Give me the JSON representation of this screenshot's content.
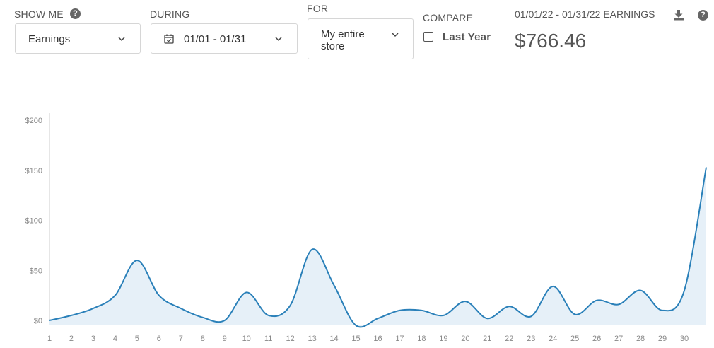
{
  "controls": {
    "show_me": {
      "label": "SHOW ME",
      "value": "Earnings"
    },
    "during": {
      "label": "DURING",
      "value": "01/01 - 01/31"
    },
    "for": {
      "label": "FOR",
      "value_line1": "My entire",
      "value_line2": "store"
    },
    "compare": {
      "label": "COMPARE",
      "option": "Last Year",
      "checked": false
    }
  },
  "summary": {
    "label": "01/01/22 - 01/31/22 EARNINGS",
    "value": "$766.46"
  },
  "icons": {
    "help": "help-icon",
    "download": "download-icon",
    "calendar": "calendar-icon",
    "chevron": "chevron-down-icon"
  },
  "colors": {
    "line": "#2a80b9",
    "area": "#e6f0f8",
    "axis": "#cccccc",
    "tick_text": "#888888"
  },
  "chart_data": {
    "type": "area",
    "x": [
      1,
      2,
      3,
      4,
      5,
      6,
      7,
      8,
      9,
      10,
      11,
      12,
      13,
      14,
      15,
      16,
      17,
      18,
      19,
      20,
      21,
      22,
      23,
      24,
      25,
      26,
      27,
      28,
      29,
      30,
      31
    ],
    "xticks": [
      "1",
      "2",
      "3",
      "4",
      "5",
      "6",
      "7",
      "8",
      "9",
      "10",
      "11",
      "12",
      "13",
      "14",
      "15",
      "16",
      "17",
      "18",
      "19",
      "20",
      "21",
      "22",
      "23",
      "24",
      "25",
      "26",
      "27",
      "28",
      "29",
      "30"
    ],
    "y": [
      0,
      5,
      12,
      25,
      60,
      25,
      12,
      3,
      0,
      28,
      5,
      15,
      71,
      35,
      -5,
      2,
      10,
      10,
      5,
      19,
      2,
      14,
      4,
      34,
      6,
      20,
      16,
      30,
      10,
      30,
      153
    ],
    "yticks": [
      "$0",
      "$50",
      "$100",
      "$150",
      "$200"
    ],
    "ylim": [
      0,
      200
    ],
    "grid": false
  }
}
